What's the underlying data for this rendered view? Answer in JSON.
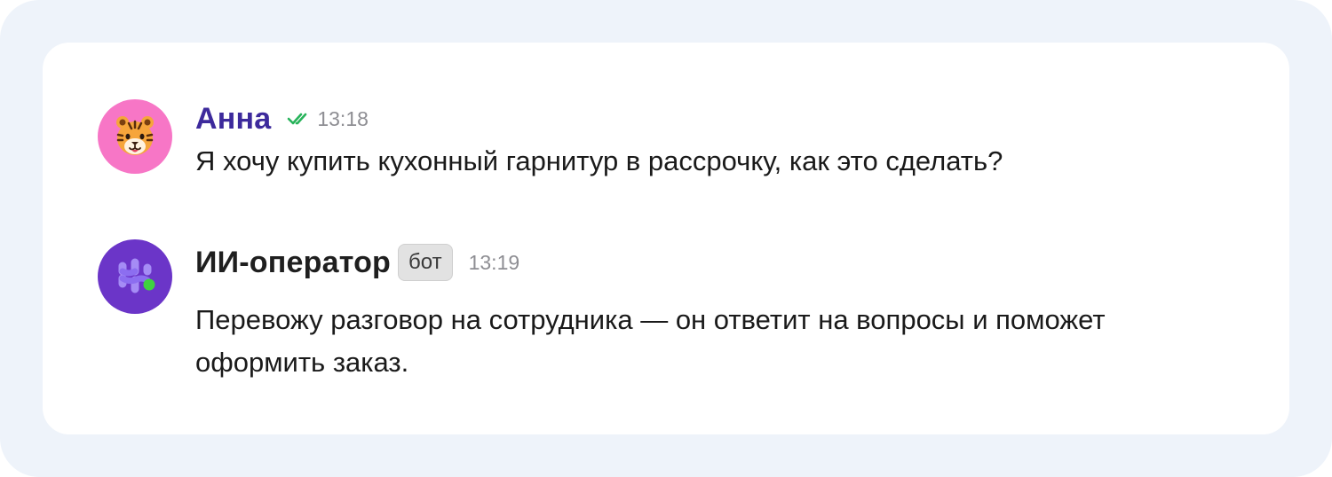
{
  "messages": [
    {
      "author": "Анна",
      "time": "13:18",
      "status_icon": "double-check-icon",
      "avatar_icon": "tiger-emoji",
      "text": "Я хочу купить кухонный гарнитур в рассрочку, как это сделать?"
    },
    {
      "author": "ИИ-оператор",
      "badge": "бот",
      "time": "13:19",
      "avatar_icon": "ai-operator-logo",
      "text": "Перевожу разговор на сотрудника — он ответит на вопросы и поможет оформить заказ."
    }
  ],
  "colors": {
    "anna_name": "#3d2a9c",
    "anna_avatar": "#f776c6",
    "bot_avatar": "#6b35c8",
    "check": "#27b35a",
    "frame_bg": "#eef3fa"
  }
}
